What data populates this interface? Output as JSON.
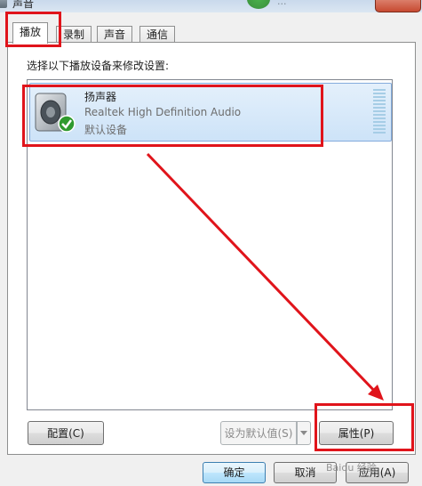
{
  "window": {
    "title": "声音"
  },
  "background_text": "...",
  "tabs": [
    "播放",
    "录制",
    "声音",
    "通信"
  ],
  "instruction": "选择以下播放设备来修改设置:",
  "device": {
    "name": "扬声器",
    "description": "Realtek High Definition Audio",
    "status": "默认设备"
  },
  "buttons": {
    "configure": "配置(C)",
    "set_default": "设为默认值(S)",
    "properties": "属性(P)",
    "ok": "确定",
    "cancel": "取消",
    "apply": "应用(A)"
  },
  "watermark": "Baidu 经验",
  "colors": {
    "annotation_red": "#e0141b",
    "selection_blue": "#cde3f8"
  }
}
